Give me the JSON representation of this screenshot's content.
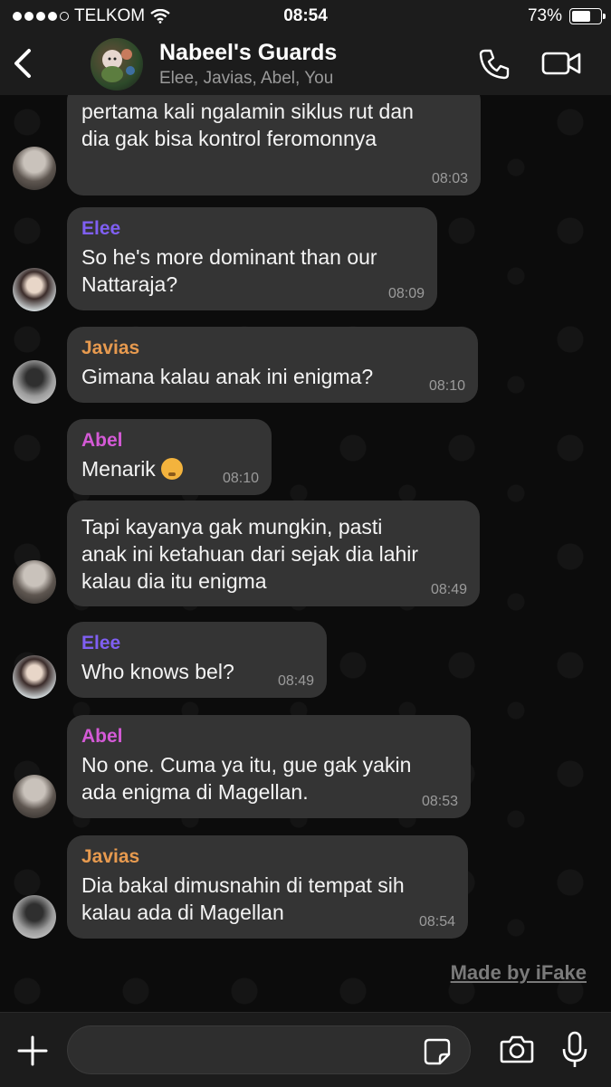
{
  "status_bar": {
    "carrier": "TELKOM",
    "time": "08:54",
    "battery": "73%",
    "battery_level": 0.73,
    "signal_bars_filled": 4,
    "signal_bars_total": 5
  },
  "header": {
    "title": "Nabeel's Guards",
    "subtitle": "Elee, Javias, Abel, You"
  },
  "colors": {
    "elee": "#7f5ff2",
    "javias": "#e79a4f",
    "abel": "#d45ad6"
  },
  "messages": [
    {
      "sender": "",
      "lines": [
        "pertama kali ngalamin siklus rut dan",
        "dia gak bisa kontrol feromonnya"
      ],
      "time": "08:03"
    },
    {
      "sender": "Elee",
      "lines": [
        "So he's more dominant than our",
        "Nattaraja?"
      ],
      "time": "08:09"
    },
    {
      "sender": "Javias",
      "lines": [
        "Gimana kalau anak ini enigma?"
      ],
      "time": "08:10"
    },
    {
      "sender": "Abel",
      "lines": [
        "Menarik"
      ],
      "emoji": "thinking-face",
      "time": "08:10"
    },
    {
      "sender": "",
      "lines": [
        "Tapi kayanya gak mungkin, pasti",
        "anak ini ketahuan dari sejak dia lahir",
        "kalau dia itu enigma"
      ],
      "time": "08:49"
    },
    {
      "sender": "Elee",
      "lines": [
        "Who knows bel?"
      ],
      "time": "08:49"
    },
    {
      "sender": "Abel",
      "lines": [
        "No one. Cuma ya itu, gue gak yakin",
        "ada enigma di Magellan."
      ],
      "time": "08:53"
    },
    {
      "sender": "Javias",
      "lines": [
        "Dia bakal dimusnahin di tempat sih",
        "kalau ada di Magellan"
      ],
      "time": "08:54"
    }
  ],
  "watermark": "Made by iFake",
  "input": {
    "value": "",
    "placeholder": ""
  },
  "icons": {
    "back": "chevron-left-icon",
    "call": "phone-icon",
    "video": "video-camera-icon",
    "plus": "plus-icon",
    "sticker": "sticker-icon",
    "camera": "camera-icon",
    "mic": "microphone-icon"
  }
}
